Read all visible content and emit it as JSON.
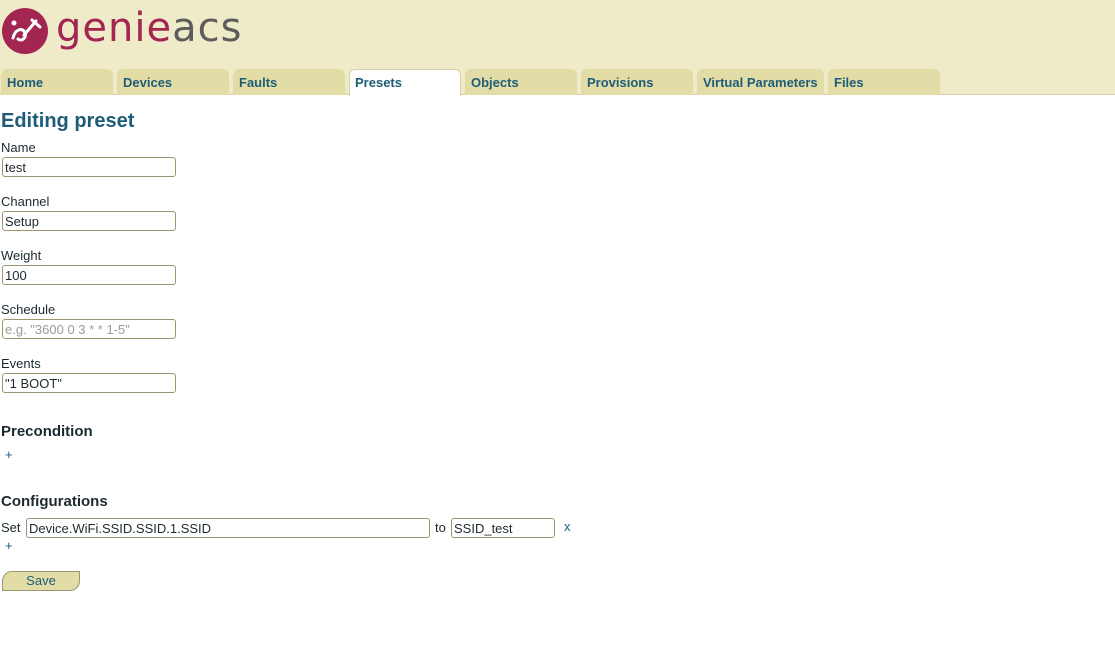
{
  "logo": {
    "part1": "genie",
    "part2": "acs"
  },
  "tabs": [
    {
      "label": "Home",
      "active": false
    },
    {
      "label": "Devices",
      "active": false
    },
    {
      "label": "Faults",
      "active": false
    },
    {
      "label": "Presets",
      "active": true
    },
    {
      "label": "Objects",
      "active": false
    },
    {
      "label": "Provisions",
      "active": false
    },
    {
      "label": "Virtual Parameters",
      "active": false
    },
    {
      "label": "Files",
      "active": false
    }
  ],
  "page": {
    "title": "Editing preset"
  },
  "form": {
    "name": {
      "label": "Name",
      "value": "test"
    },
    "channel": {
      "label": "Channel",
      "value": "Setup"
    },
    "weight": {
      "label": "Weight",
      "value": "100"
    },
    "schedule": {
      "label": "Schedule",
      "value": "",
      "placeholder": "e.g. \"3600 0 3 * * 1-5\""
    },
    "events": {
      "label": "Events",
      "value": "\"1 BOOT\""
    }
  },
  "precondition": {
    "title": "Precondition",
    "add_label": "+"
  },
  "configurations": {
    "title": "Configurations",
    "rows": [
      {
        "verb": "Set",
        "parameter": "Device.WiFi.SSID.SSID.1.SSID",
        "to_label": "to",
        "value": "SSID_test",
        "remove_label": "x"
      }
    ],
    "add_label": "+"
  },
  "save_label": "Save",
  "colors": {
    "header_bg": "#efebc9",
    "tab_bg": "#e2dda6",
    "link": "#1e5c78",
    "logo_accent": "#a22552",
    "logo_gray": "#5c5c5c"
  }
}
